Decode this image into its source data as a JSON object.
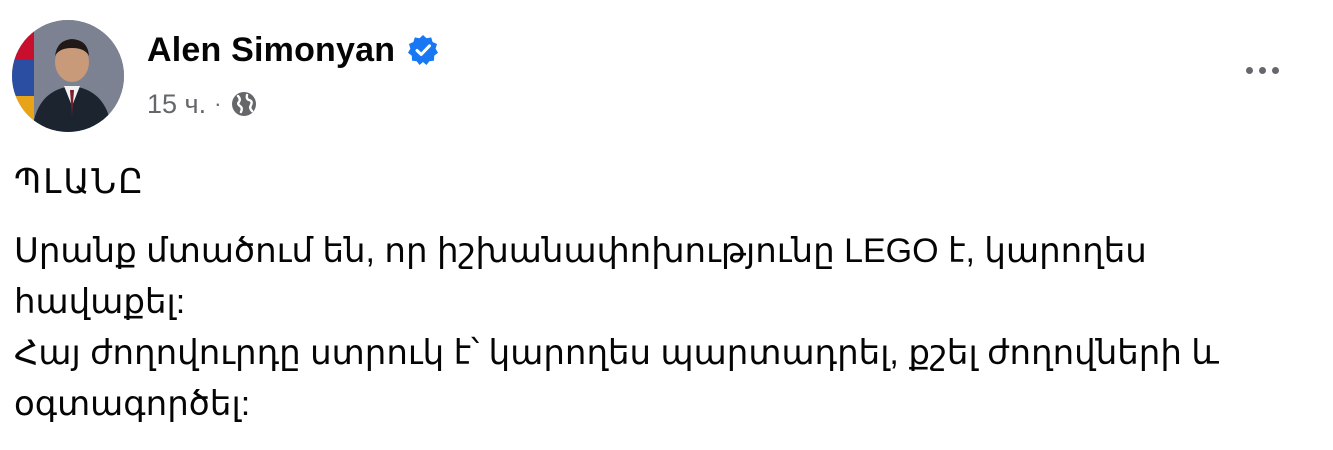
{
  "post": {
    "author_name": "Alen Simonyan",
    "verified_icon": "verified-badge-icon",
    "time": "15 ч.",
    "separator": "·",
    "audience_icon": "globe-icon",
    "more_icon": "more-options-icon",
    "title": "ՊԼԱՆԸ",
    "lines": [
      "Սրանք մտածում են, որ իշխանափոխությունը LEGO է, կարողես",
      "հավաքել:",
      "Հայ ժողովուրդը ստրուկ է՝ կարողես պարտադրել, քշել ժողովների և",
      "օգտագործել:"
    ]
  },
  "colors": {
    "verified_blue": "#1877f2",
    "meta_gray": "#65676b",
    "text_black": "#050505"
  }
}
